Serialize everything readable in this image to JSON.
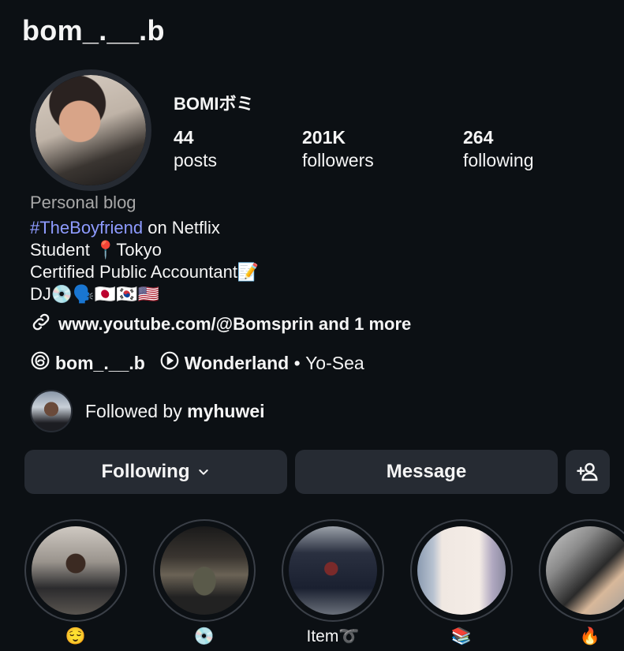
{
  "header": {
    "username": "bom_.__.b"
  },
  "profile": {
    "display_name": "BOMIボミ",
    "stats": [
      {
        "value": "44",
        "label": "posts"
      },
      {
        "value": "201K",
        "label": "followers"
      },
      {
        "value": "264",
        "label": "following"
      }
    ],
    "category": "Personal blog",
    "bio": {
      "hashtag": "#TheBoyfriend",
      "hashtag_suffix": " on Netflix",
      "line2": "Student 📍Tokyo",
      "line3": "Certified Public Accountant📝",
      "line4": "DJ💿🗣️🇯🇵🇰🇷🇺🇸"
    },
    "link": {
      "url": "www.youtube.com/@Bomsprin",
      "more": " and 1 more"
    },
    "threads_handle": "bom_.__.b",
    "music": {
      "song": "Wonderland",
      "separator": " • ",
      "artist": "Yo-Sea"
    },
    "followed_by": {
      "prefix": "Followed by ",
      "user": "myhuwei"
    }
  },
  "actions": {
    "following_label": "Following",
    "message_label": "Message"
  },
  "highlights": [
    {
      "label": "😌"
    },
    {
      "label": "💿"
    },
    {
      "label": "Item➰"
    },
    {
      "label": "📚"
    },
    {
      "label": "🔥"
    }
  ],
  "colors": {
    "background": "#0c1014",
    "button": "#262b33",
    "hashtag": "#8e9bff",
    "muted": "#a8a8a8"
  }
}
